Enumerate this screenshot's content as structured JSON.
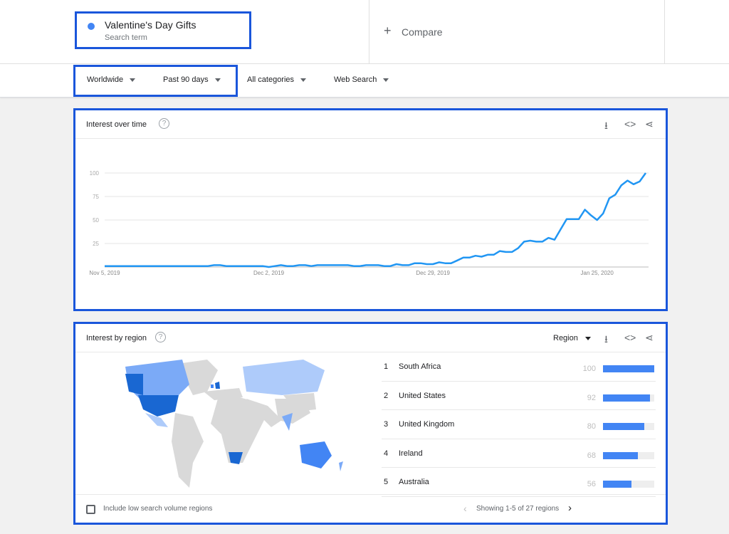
{
  "search": {
    "term": "Valentine's Day Gifts",
    "subtitle": "Search term",
    "color": "#4285f4",
    "compare_label": "Compare"
  },
  "filters": [
    {
      "label": "Worldwide"
    },
    {
      "label": "Past 90 days"
    },
    {
      "label": "All categories"
    },
    {
      "label": "Web Search"
    }
  ],
  "interest_over_time": {
    "title": "Interest over time",
    "help": "?"
  },
  "chart_data": {
    "type": "line",
    "start_date": "2019-11-05",
    "end_date": "2020-02-02",
    "interval": "daily",
    "ylim": [
      0,
      100
    ],
    "yticks": [
      "100",
      "75",
      "50",
      "25"
    ],
    "xticks": [
      "Nov 5, 2019",
      "Dec 2, 2019",
      "Dec 29, 2019",
      "Jan 25, 2020"
    ],
    "grid": true,
    "line_color": "#2196f3",
    "values": [
      1,
      1,
      1,
      1,
      1,
      1,
      1,
      1,
      1,
      1,
      1,
      1,
      1,
      1,
      1,
      1,
      1,
      1,
      2,
      2,
      1,
      1,
      1,
      1,
      1,
      1,
      1,
      0,
      1,
      2,
      1,
      1,
      2,
      2,
      1,
      2,
      2,
      2,
      2,
      2,
      2,
      1,
      1,
      2,
      2,
      2,
      1,
      1,
      3,
      2,
      2,
      4,
      4,
      3,
      3,
      5,
      4,
      4,
      7,
      10,
      10,
      12,
      11,
      13,
      13,
      17,
      16,
      16,
      20,
      27,
      28,
      27,
      27,
      31,
      29,
      40,
      51,
      51,
      51,
      61,
      55,
      50,
      57,
      73,
      77,
      87,
      92,
      88,
      91,
      100
    ]
  },
  "interest_by_region": {
    "title": "Interest by region",
    "help": "?",
    "selector": "Region",
    "regions": [
      {
        "rank": "1",
        "name": "South Africa",
        "value": 100
      },
      {
        "rank": "2",
        "name": "United States",
        "value": 92
      },
      {
        "rank": "3",
        "name": "United Kingdom",
        "value": 80
      },
      {
        "rank": "4",
        "name": "Ireland",
        "value": 68
      },
      {
        "rank": "5",
        "name": "Australia",
        "value": 56
      }
    ],
    "include_low_label": "Include low search volume regions",
    "pagination": "Showing 1-5 of 27 regions"
  },
  "icons": {
    "download": "download-icon",
    "embed": "code-icon",
    "share": "share-icon"
  }
}
